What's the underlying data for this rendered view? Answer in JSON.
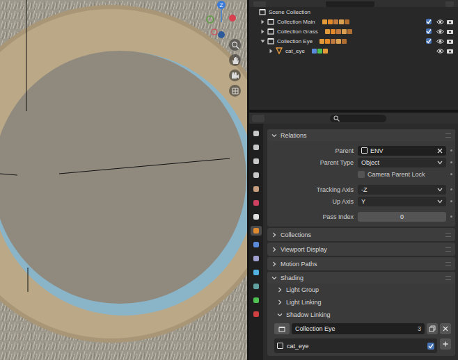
{
  "viewport": {
    "gizmo": {
      "axis_label": "Z"
    }
  },
  "outliner": {
    "items": [
      {
        "label": "Scene Collection",
        "kind": "scene",
        "depth": 0,
        "expanded": true
      },
      {
        "label": "Collection Main",
        "kind": "collection",
        "depth": 1,
        "expanded": false,
        "checked": true,
        "visible": true,
        "renderable": true
      },
      {
        "label": "Collection Grass",
        "kind": "collection",
        "depth": 1,
        "expanded": false,
        "checked": true,
        "visible": true,
        "renderable": true
      },
      {
        "label": "Collection Eye",
        "kind": "collection",
        "depth": 1,
        "expanded": true,
        "checked": true,
        "visible": true,
        "renderable": true
      },
      {
        "label": "cat_eye",
        "kind": "object",
        "depth": 2,
        "expanded": false,
        "visible": true,
        "renderable": true
      }
    ]
  },
  "properties": {
    "tabs": [
      {
        "selected": false
      },
      {
        "selected": false
      },
      {
        "selected": false
      },
      {
        "selected": false
      },
      {
        "selected": false
      },
      {
        "selected": false
      },
      {
        "selected": false
      },
      {
        "selected": true
      },
      {
        "selected": false
      },
      {
        "selected": false
      },
      {
        "selected": false
      },
      {
        "selected": false
      },
      {
        "selected": false
      },
      {
        "selected": false
      }
    ],
    "relations": {
      "title": "Relations",
      "expanded": true,
      "fields": [
        {
          "label": "Parent",
          "kind": "object",
          "value": "ENV"
        },
        {
          "label": "Parent Type",
          "kind": "dropdown",
          "value": "Object"
        },
        {
          "label": "Camera Parent Lock",
          "kind": "checkbox",
          "checked": false
        },
        {
          "label": "Tracking Axis",
          "kind": "dropdown",
          "value": "-Z"
        },
        {
          "label": "Up Axis",
          "kind": "dropdown",
          "value": "Y"
        },
        {
          "label": "Pass Index",
          "kind": "number",
          "value": "0"
        }
      ]
    },
    "sections": [
      {
        "title": "Collections",
        "expanded": false
      },
      {
        "title": "Viewport Display",
        "expanded": false
      },
      {
        "title": "Motion Paths",
        "expanded": false
      }
    ],
    "shading": {
      "title": "Shading",
      "expanded": true,
      "subsections": [
        {
          "title": "Light Group",
          "expanded": false
        },
        {
          "title": "Light Linking",
          "expanded": false
        },
        {
          "title": "Shadow Linking",
          "expanded": true
        }
      ],
      "shadow_linking": {
        "collection": "Collection Eye",
        "users": "3",
        "items": [
          {
            "label": "cat_eye",
            "checked": true
          }
        ]
      }
    }
  }
}
